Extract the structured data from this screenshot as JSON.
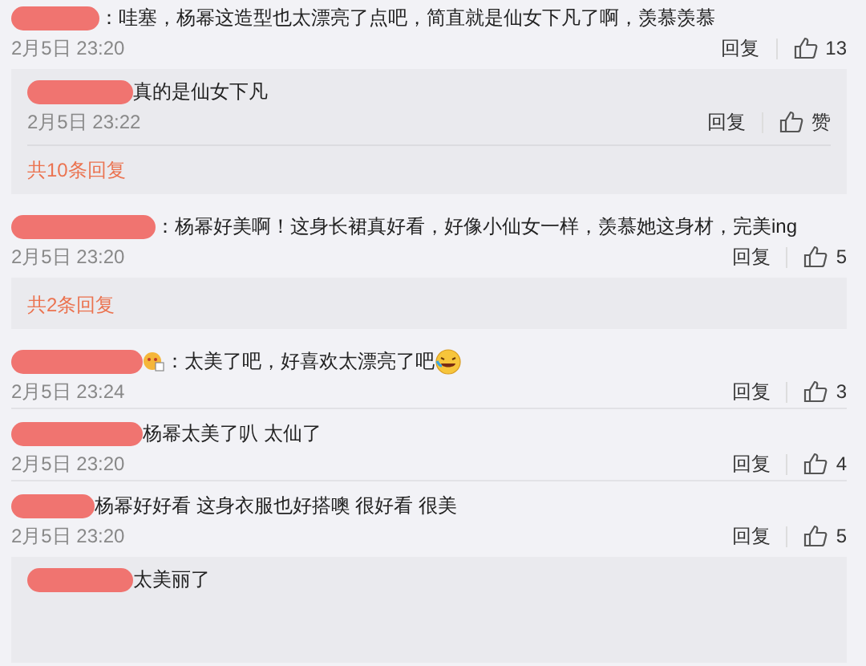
{
  "comments": [
    {
      "content": [
        {
          "kind": "text",
          "text": "：哇塞，杨幂这造型也太漂亮了点吧，简直就是仙女下凡了啊，羡慕羡慕"
        }
      ],
      "time": "2月5日 23:20",
      "reply": "回复",
      "likes": "13",
      "thread": {
        "replies": [
          {
            "content": [
              {
                "kind": "text",
                "text": "真的是仙女下凡"
              }
            ],
            "time": "2月5日 23:22",
            "reply": "回复",
            "likes": "赞"
          }
        ],
        "more": "共10条回复"
      }
    },
    {
      "content": [
        {
          "kind": "text",
          "text": "：杨幂好美啊！这身长裙真好看，好像小仙女一样，羡慕她这身材，完美ing"
        }
      ],
      "time": "2月5日 23:20",
      "reply": "回复",
      "likes": "5",
      "thread": {
        "more": "共2条回复"
      }
    },
    {
      "content": [
        {
          "kind": "badge"
        },
        {
          "kind": "text",
          "text": "：太美了吧，好喜欢太漂亮了吧"
        },
        {
          "kind": "laughing"
        }
      ],
      "time": "2月5日 23:24",
      "reply": "回复",
      "likes": "3"
    },
    {
      "content": [
        {
          "kind": "text",
          "text": "杨幂太美了叭 太仙了"
        }
      ],
      "time": "2月5日 23:20",
      "reply": "回复",
      "likes": "4"
    },
    {
      "content": [
        {
          "kind": "text",
          "text": "杨幂好好看 这身衣服也好搭噢 很好看 很美"
        }
      ],
      "time": "2月5日 23:20",
      "reply": "回复",
      "likes": "5",
      "thread": {
        "replies": [
          {
            "content": [
              {
                "kind": "text",
                "text": "太美丽了"
              }
            ]
          }
        ]
      }
    }
  ]
}
